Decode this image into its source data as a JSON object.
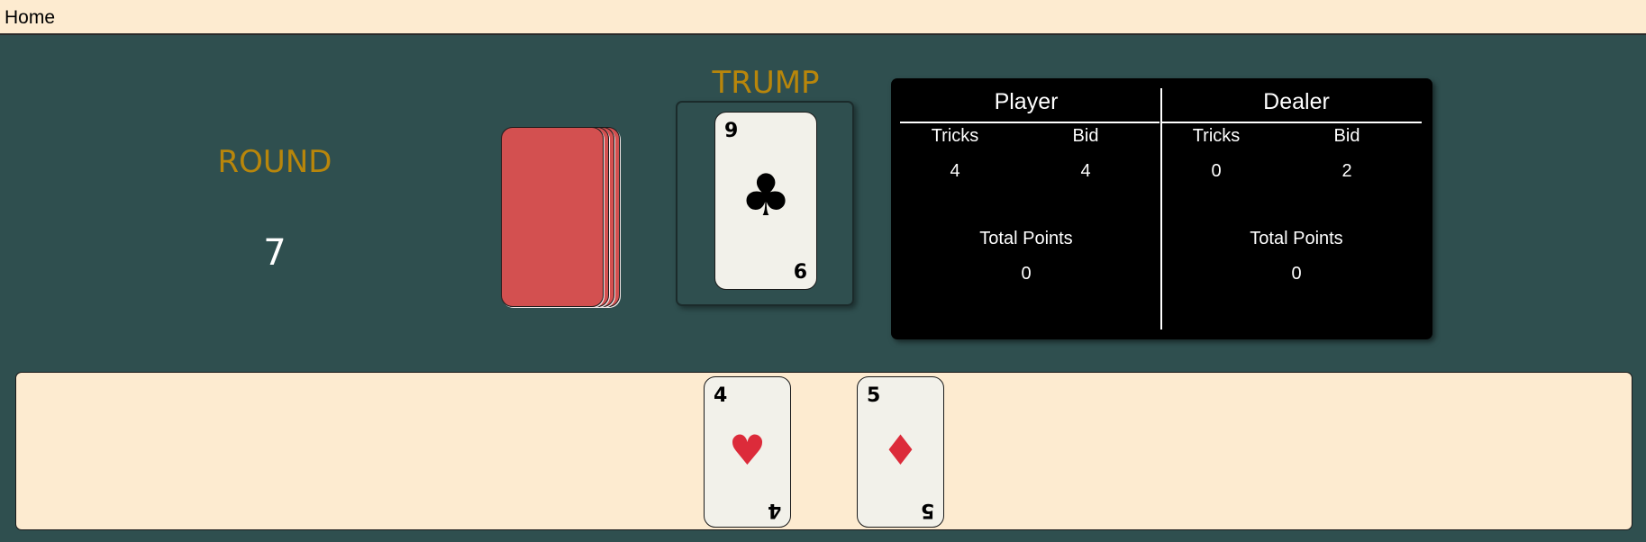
{
  "nav": {
    "home": "Home"
  },
  "round": {
    "label": "ROUND",
    "value": "7"
  },
  "trump": {
    "label": "TRUMP",
    "card": {
      "rank": "9",
      "suit": "♣",
      "color": "#000000",
      "corner_br": "6"
    }
  },
  "scoreboard": {
    "player": {
      "title": "Player",
      "tricks_label": "Tricks",
      "bid_label": "Bid",
      "tricks": "4",
      "bid": "4",
      "total_label": "Total Points",
      "total": "0"
    },
    "dealer": {
      "title": "Dealer",
      "tricks_label": "Tricks",
      "bid_label": "Bid",
      "tricks": "0",
      "bid": "2",
      "total_label": "Total Points",
      "total": "0"
    }
  },
  "hand": [
    {
      "rank": "4",
      "suit": "♥",
      "color": "#dc2b3a"
    },
    {
      "rank": "5",
      "suit": "♦",
      "color": "#dc2b3a"
    }
  ],
  "colors": {
    "table": "#2f4f4f",
    "accent": "#b8860b",
    "cream": "#fdebd0",
    "card_back": "#d35050"
  }
}
